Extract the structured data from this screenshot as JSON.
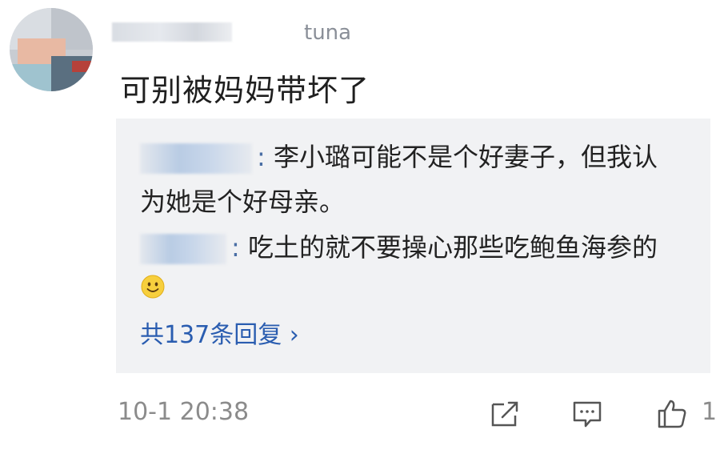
{
  "comment": {
    "username_tail": "tuna",
    "text": "可别被妈妈带坏了",
    "timestamp": "10-1 20:38",
    "like_count": "1"
  },
  "replies": [
    {
      "separator": ":",
      "text_line1": "李小璐可能不是个好妻子，但我认",
      "text_line2": "为她是个好母亲。"
    },
    {
      "separator": ":",
      "text_line1": "吃土的就不要操心那些吃鲍鱼海参的"
    }
  ],
  "more_replies_label": "共137条回复 ›",
  "icons": {
    "avatar": "avatar",
    "share": "share-icon",
    "comment": "comment-icon",
    "like": "thumbs-up-icon",
    "smile": "smile-emoji-icon"
  },
  "colors": {
    "link": "#2a5db0",
    "reply_bg": "#f1f2f4",
    "meta": "#8b8b8b"
  }
}
